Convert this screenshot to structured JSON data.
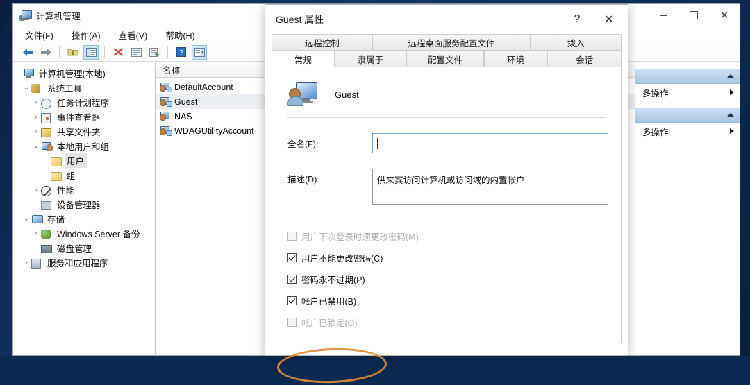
{
  "window": {
    "title": "计算机管理",
    "icon": "computer-management-icon",
    "controls": {
      "minimize": "–",
      "maximize": "□",
      "close": "✕"
    },
    "menu": [
      "文件(F)",
      "操作(A)",
      "查看(V)",
      "帮助(H)"
    ],
    "toolbar": [
      {
        "name": "back-icon",
        "glyph": "⬅"
      },
      {
        "name": "forward-icon",
        "glyph": "➡"
      },
      {
        "name": "up-folder-icon",
        "glyph": "📁"
      },
      {
        "name": "show-tree-icon",
        "glyph": "▤"
      },
      {
        "name": "delete-icon",
        "glyph": "✖"
      },
      {
        "name": "properties-icon",
        "glyph": "▦"
      },
      {
        "name": "export-list-icon",
        "glyph": "▤"
      },
      {
        "name": "help-icon",
        "glyph": "?"
      },
      {
        "name": "show-action-pane-icon",
        "glyph": "▣"
      }
    ]
  },
  "tree": {
    "root": "计算机管理(本地)",
    "nodes": [
      {
        "label": "计算机管理(本地)",
        "indent": 0,
        "expander": "",
        "icon": "computer-icon",
        "selected": false
      },
      {
        "label": "系统工具",
        "indent": 1,
        "expander": "⌄",
        "icon": "system-tools-icon",
        "selected": false
      },
      {
        "label": "任务计划程序",
        "indent": 2,
        "expander": "›",
        "icon": "task-scheduler-icon",
        "selected": false
      },
      {
        "label": "事件查看器",
        "indent": 2,
        "expander": "›",
        "icon": "event-viewer-icon",
        "selected": false
      },
      {
        "label": "共享文件夹",
        "indent": 2,
        "expander": "›",
        "icon": "shared-folders-icon",
        "selected": false
      },
      {
        "label": "本地用户和组",
        "indent": 2,
        "expander": "⌄",
        "icon": "local-users-groups-icon",
        "selected": false
      },
      {
        "label": "用户",
        "indent": 3,
        "expander": "",
        "icon": "folder-icon",
        "selected": true
      },
      {
        "label": "组",
        "indent": 3,
        "expander": "",
        "icon": "folder-icon",
        "selected": false
      },
      {
        "label": "性能",
        "indent": 2,
        "expander": "›",
        "icon": "performance-icon",
        "selected": false
      },
      {
        "label": "设备管理器",
        "indent": 2,
        "expander": "",
        "icon": "device-manager-icon",
        "selected": false
      },
      {
        "label": "存储",
        "indent": 1,
        "expander": "⌄",
        "icon": "storage-icon",
        "selected": false
      },
      {
        "label": "Windows Server 备份",
        "indent": 2,
        "expander": "›",
        "icon": "backup-icon",
        "selected": false
      },
      {
        "label": "磁盘管理",
        "indent": 2,
        "expander": "",
        "icon": "disk-management-icon",
        "selected": false
      },
      {
        "label": "服务和应用程序",
        "indent": 1,
        "expander": "›",
        "icon": "services-apps-icon",
        "selected": false
      }
    ]
  },
  "list": {
    "column_header": "名称",
    "rows": [
      {
        "name": "DefaultAccount",
        "selected": false
      },
      {
        "name": "Guest",
        "selected": true
      },
      {
        "name": "NAS",
        "selected": false
      },
      {
        "name": "WDAGUtilityAccount",
        "selected": false
      }
    ]
  },
  "actions": {
    "groups": [
      {
        "more_actions": "多操作"
      },
      {
        "more_actions": "多操作"
      }
    ]
  },
  "dialog": {
    "title": "Guest 属性",
    "help_button": "?",
    "close_button": "✕",
    "tabs_top": [
      "远程控制",
      "远程桌面服务配置文件",
      "拨入"
    ],
    "tabs_bottom": [
      "常规",
      "隶属于",
      "配置文件",
      "环境",
      "会话"
    ],
    "active_tab": "常规",
    "user_name": "Guest",
    "user_icon": "user-account-icon",
    "fields": [
      {
        "label": "全名(F):",
        "value": "",
        "type": "input"
      },
      {
        "label": "描述(D):",
        "value": "供来宾访问计算机或访问域的内置帐户",
        "type": "textarea"
      }
    ],
    "checkboxes": [
      {
        "label": "用户下次登录时须更改密码(M)",
        "checked": false,
        "disabled": true
      },
      {
        "label": "用户不能更改密码(C)",
        "checked": true,
        "disabled": false
      },
      {
        "label": "密码永不过期(P)",
        "checked": true,
        "disabled": false
      },
      {
        "label": "帐户已禁用(B)",
        "checked": true,
        "disabled": false,
        "highlighted": true
      },
      {
        "label": "帐户已锁定(O)",
        "checked": false,
        "disabled": true
      }
    ]
  },
  "colors": {
    "annotation": "#e08b32",
    "accent": "#cde6f7",
    "desktop": "#0d2d58",
    "selection": "#eceff3"
  }
}
